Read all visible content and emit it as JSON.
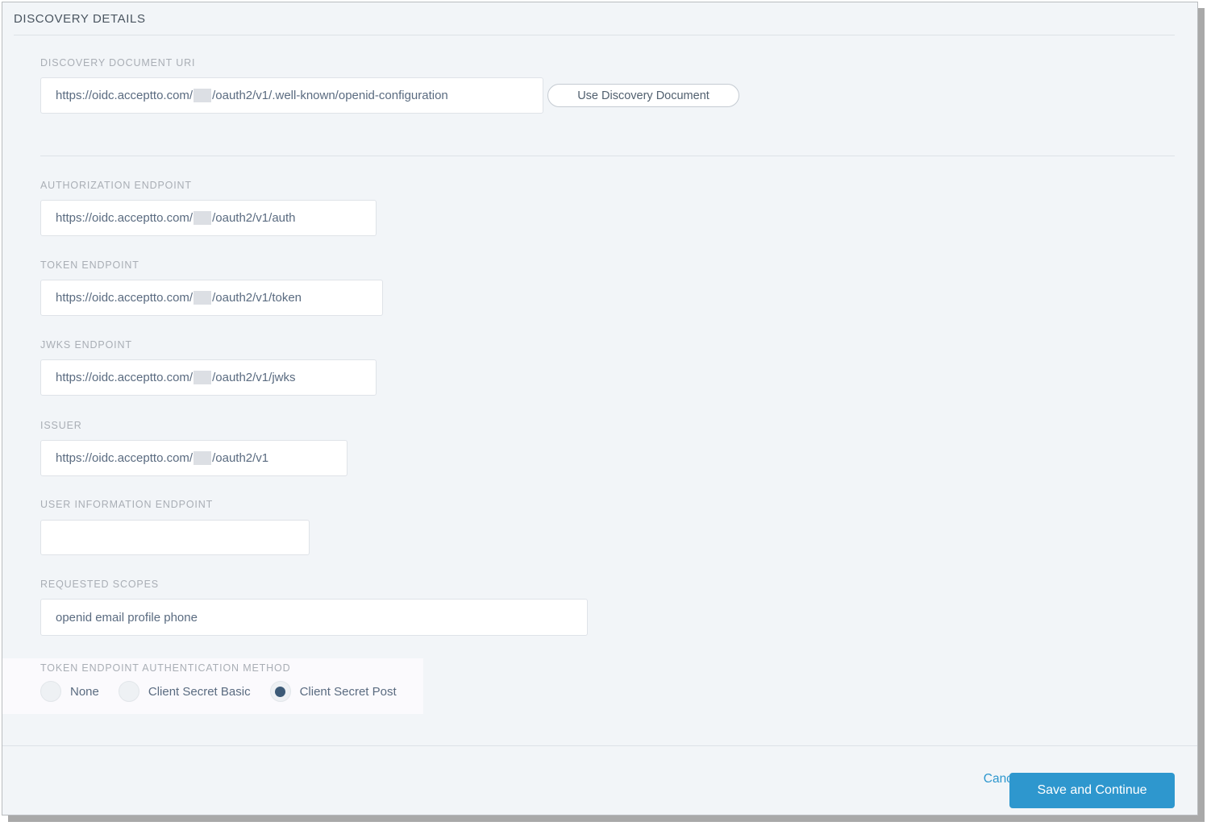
{
  "section": {
    "title": "DISCOVERY DETAILS"
  },
  "fields": {
    "discovery_document_uri": {
      "label": "DISCOVERY DOCUMENT URI",
      "value_prefix": "https://oidc.acceptto.com/",
      "value_suffix": "/oauth2/v1/.well-known/openid-configuration",
      "redacted": true
    },
    "authorization_endpoint": {
      "label": "AUTHORIZATION ENDPOINT",
      "value_prefix": "https://oidc.acceptto.com/",
      "value_suffix": "/oauth2/v1/auth",
      "redacted": true
    },
    "token_endpoint": {
      "label": "TOKEN ENDPOINT",
      "value_prefix": "https://oidc.acceptto.com/",
      "value_suffix": "/oauth2/v1/token",
      "redacted": true
    },
    "jwks_endpoint": {
      "label": "JWKS ENDPOINT",
      "value_prefix": "https://oidc.acceptto.com/",
      "value_suffix": "/oauth2/v1/jwks",
      "redacted": true
    },
    "issuer": {
      "label": "ISSUER",
      "value_prefix": "https://oidc.acceptto.com/",
      "value_suffix": "/oauth2/v1",
      "redacted": true
    },
    "user_information_endpoint": {
      "label": "USER INFORMATION ENDPOINT",
      "value": "",
      "placeholder": ""
    },
    "requested_scopes": {
      "label": "REQUESTED SCOPES",
      "value": "openid email profile phone"
    }
  },
  "buttons": {
    "use_discovery_document": "Use Discovery Document",
    "cancel": "Cancel",
    "save_and_continue": "Save and Continue"
  },
  "auth_method": {
    "label": "TOKEN ENDPOINT AUTHENTICATION METHOD",
    "options": [
      {
        "label": "None",
        "selected": false
      },
      {
        "label": "Client Secret Basic",
        "selected": false
      },
      {
        "label": "Client Secret Post",
        "selected": true
      }
    ],
    "selected_value": "Client Secret Post"
  },
  "colors": {
    "page_background": "#f2f5f8",
    "accent_blue": "#2e97ce",
    "input_text": "#5a6b80",
    "label_grey": "#a9aeb5",
    "heading_grey": "#4a5560",
    "radio_selected": "#3c5a77",
    "redaction_block": "#dcdfe4",
    "panel_tint": "#fbfafd",
    "divider": "#dde2e7"
  }
}
